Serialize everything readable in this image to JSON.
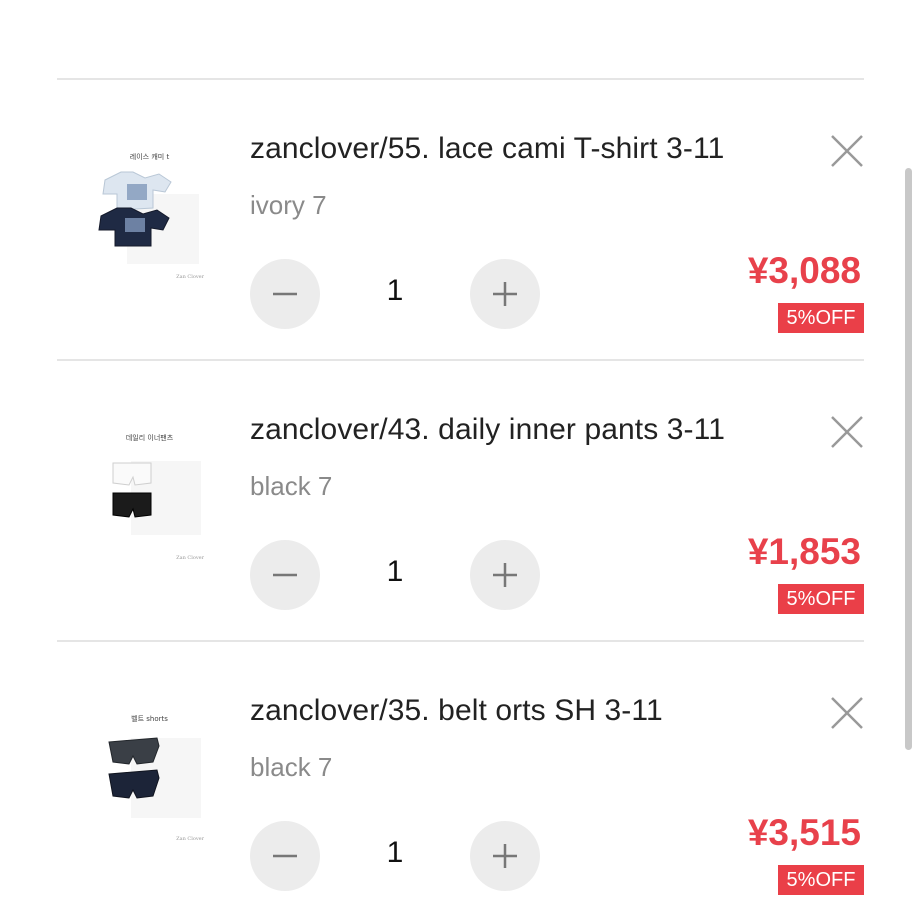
{
  "cart": {
    "items": [
      {
        "thumb_caption": "레이스 캐미 t",
        "thumb_brand": "Zan Clover",
        "title": "zanclover/55. lace cami T-shirt 3-11",
        "variant": "ivory 7",
        "quantity": "1",
        "price": "¥3,088",
        "discount": "5%OFF"
      },
      {
        "thumb_caption": "데일리 이너팬츠",
        "thumb_brand": "Zan Clover",
        "title": "zanclover/43. daily inner pants 3-11",
        "variant": "black 7",
        "quantity": "1",
        "price": "¥1,853",
        "discount": "5%OFF"
      },
      {
        "thumb_caption": "벨트 shorts",
        "thumb_brand": "Zan Clover",
        "title": "zanclover/35. belt orts SH 3-11",
        "variant": "black 7",
        "quantity": "1",
        "price": "¥3,515",
        "discount": "5%OFF"
      }
    ]
  },
  "icons": {
    "remove": "close-icon",
    "decrement": "minus-icon",
    "increment": "plus-icon"
  },
  "colors": {
    "price": "#e8414b",
    "badge_bg": "#ea3f48",
    "qty_button_bg": "#ececec",
    "divider": "#e5e5e5"
  }
}
